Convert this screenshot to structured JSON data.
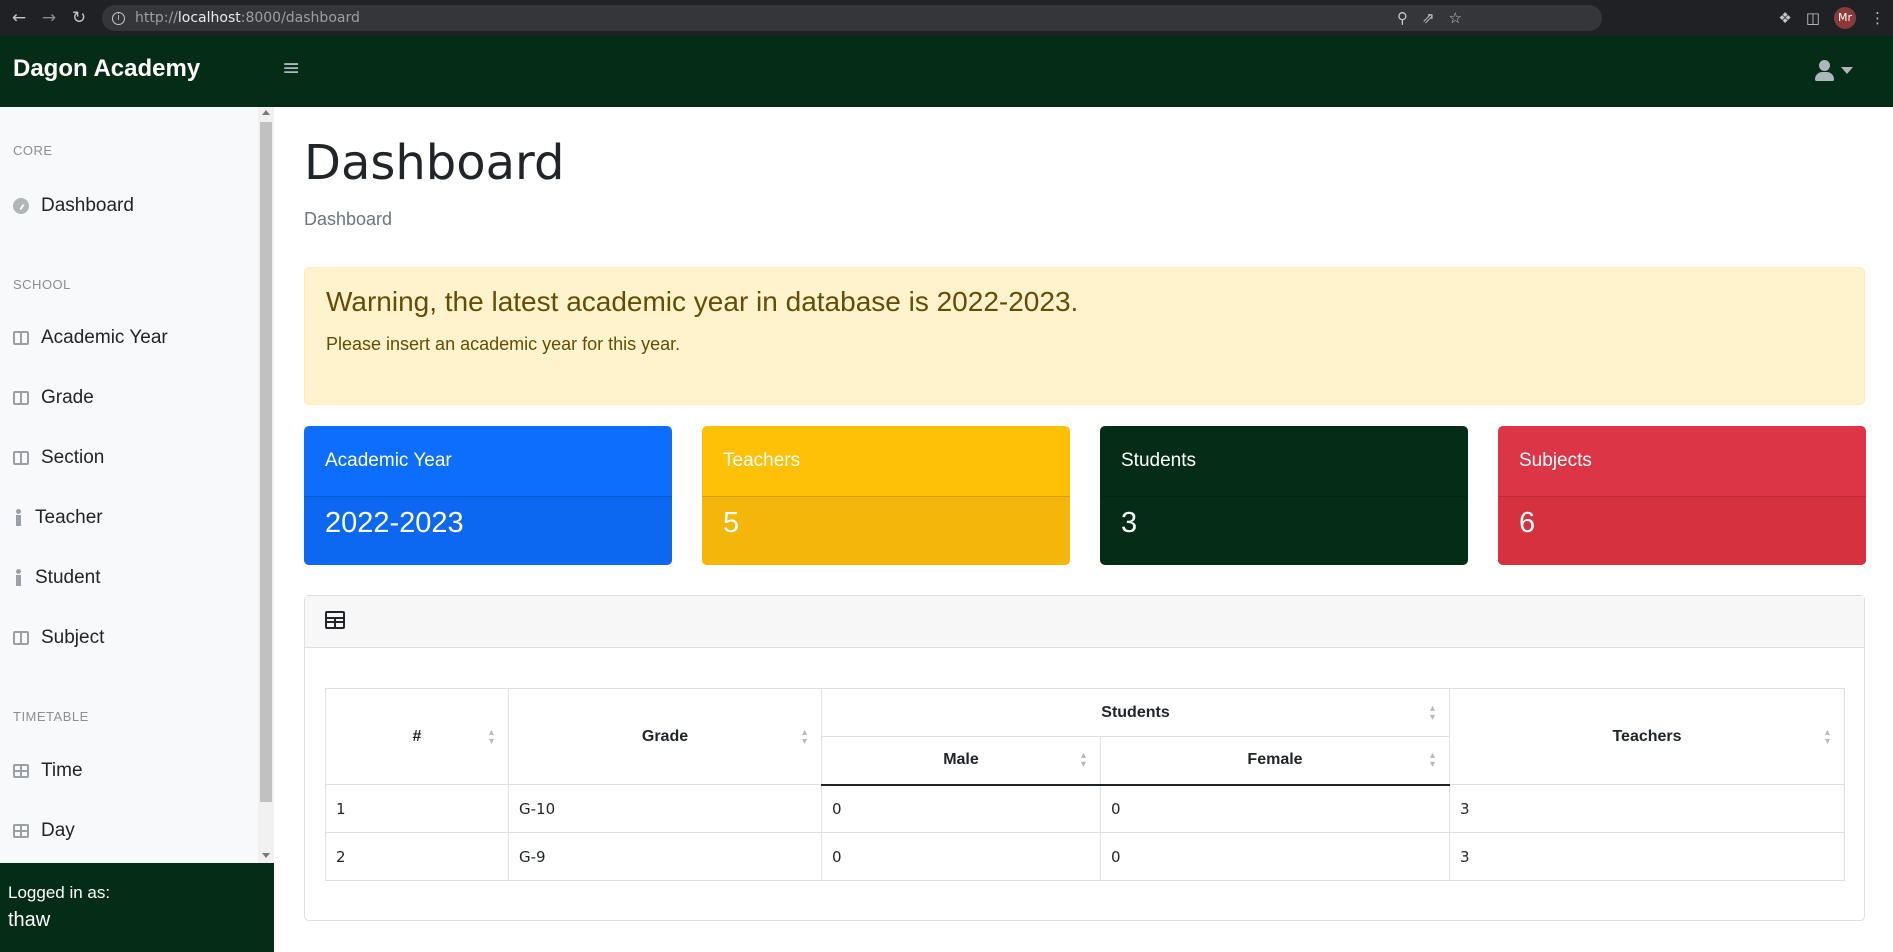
{
  "browser": {
    "url_prefix": "http://",
    "url_host": "localhost",
    "url_rest": ":8000/dashboard",
    "profile_initials": "Mr",
    "icons": [
      "back-arrow-icon",
      "forward-arrow-icon",
      "reload-icon",
      "info-icon",
      "zoom-icon",
      "share-icon",
      "star-icon",
      "extensions-icon",
      "sidepanel-icon",
      "menu-dots-icon"
    ]
  },
  "navbar": {
    "brand": "Dagon Academy",
    "toggle_icon": "hamburger-icon",
    "user_icon": "user-icon"
  },
  "sidebar": {
    "sections": [
      {
        "heading": "CORE",
        "items": [
          {
            "label": "Dashboard",
            "icon": "gauge-icon"
          }
        ]
      },
      {
        "heading": "SCHOOL",
        "items": [
          {
            "label": "Academic Year",
            "icon": "columns-icon"
          },
          {
            "label": "Grade",
            "icon": "columns-icon"
          },
          {
            "label": "Section",
            "icon": "columns-icon"
          },
          {
            "label": "Teacher",
            "icon": "person-icon"
          },
          {
            "label": "Student",
            "icon": "person-icon"
          },
          {
            "label": "Subject",
            "icon": "columns-icon"
          }
        ]
      },
      {
        "heading": "TIMETABLE",
        "items": [
          {
            "label": "Time",
            "icon": "table-icon"
          },
          {
            "label": "Day",
            "icon": "table-icon"
          }
        ]
      }
    ],
    "footer": {
      "label": "Logged in as:",
      "user": "thaw"
    }
  },
  "main": {
    "title": "Dashboard",
    "breadcrumb": "Dashboard",
    "alert": {
      "title": "Warning, the latest academic year in database is 2022-2023.",
      "text": "Please insert an academic year for this year."
    },
    "cards": [
      {
        "label": "Academic Year",
        "value": "2022-2023",
        "color": "#0d6efd"
      },
      {
        "label": "Teachers",
        "value": "5",
        "color": "#ffc107"
      },
      {
        "label": "Students",
        "value": "3",
        "color": "#052c14"
      },
      {
        "label": "Subjects",
        "value": "6",
        "color": "#dc3545"
      }
    ],
    "table": {
      "icon": "table-icon",
      "headers": {
        "index": "#",
        "grade": "Grade",
        "students": "Students",
        "male": "Male",
        "female": "Female",
        "teachers": "Teachers"
      },
      "rows": [
        [
          "1",
          "G-10",
          "0",
          "0",
          "3"
        ],
        [
          "2",
          "G-9",
          "0",
          "0",
          "3"
        ]
      ]
    }
  }
}
